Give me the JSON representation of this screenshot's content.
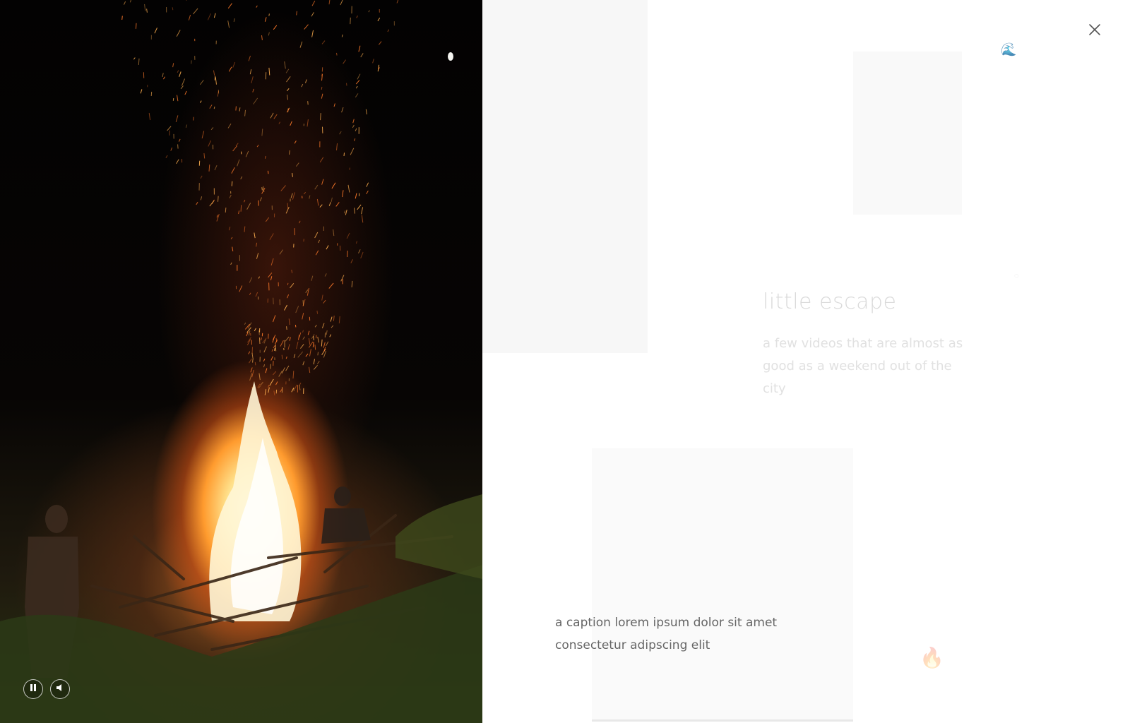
{
  "gallery": {
    "title": "little escape",
    "description": "a few videos that are almost as good as a weekend out of the city"
  },
  "lightbox": {
    "caption": "a caption lorem ipsum dolor sit amet consectetur adipscing elit",
    "media_icon": "bonfire-video",
    "controls": {
      "pause_icon": "pause-icon",
      "volume_icon": "volume-icon"
    },
    "close_icon": "close-icon"
  },
  "decorations": {
    "fire_emoji": "🔥",
    "wave_icon": "wave-icon",
    "small_icon": "dot-icon"
  }
}
